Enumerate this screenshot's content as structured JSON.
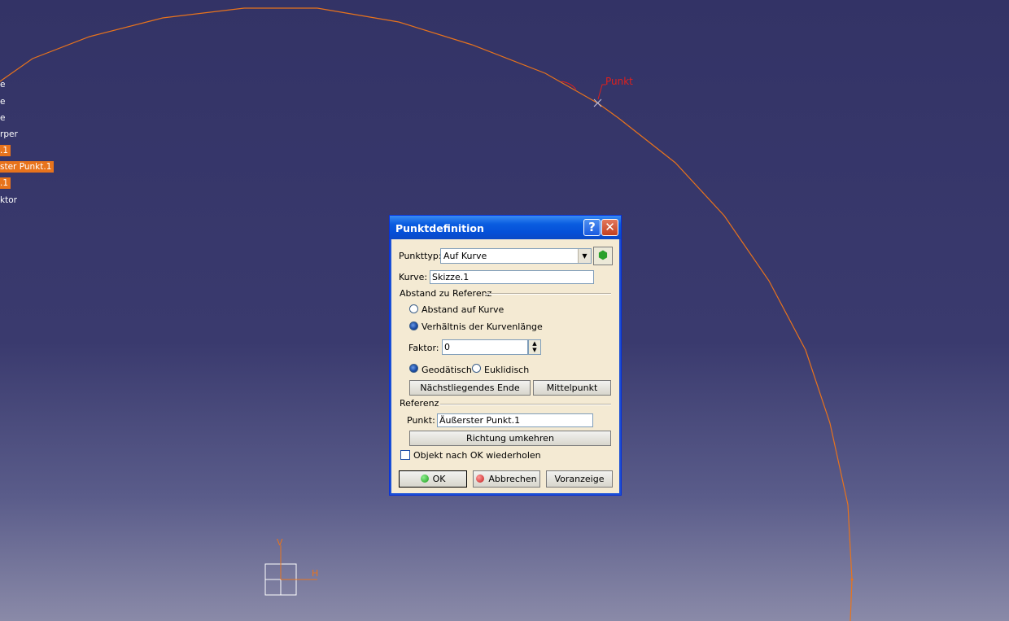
{
  "tree": {
    "items": [
      {
        "label": "e",
        "highlight": false
      },
      {
        "label": "e",
        "highlight": false
      },
      {
        "label": "e",
        "highlight": false
      },
      {
        "label": "rper",
        "highlight": false
      },
      {
        "label": ".1",
        "highlight": true
      },
      {
        "label": "ster Punkt.1",
        "highlight": true
      },
      {
        "label": ".1",
        "highlight": true
      },
      {
        "label": "ktor",
        "highlight": false
      }
    ]
  },
  "viewport": {
    "point_label": "Punkt",
    "axis_v_label": "V",
    "axis_h_label": "H",
    "curve_color": "#e8731c",
    "point_label_color": "#e0201c"
  },
  "dialog": {
    "title": "Punktdefinition",
    "help_glyph": "?",
    "close_glyph": "✕",
    "punkttyp_label": "Punkttyp:",
    "punkttyp_value": "Auf Kurve",
    "kurve_label": "Kurve:",
    "kurve_value": "Skizze.1",
    "abstand_group": "Abstand zu Referenz",
    "radio_abstand": "Abstand auf Kurve",
    "radio_verhaeltnis": "Verhältnis der Kurvenlänge",
    "faktor_label": "Faktor:",
    "faktor_value": "0",
    "radio_geodaetisch": "Geodätisch",
    "radio_euklidisch": "Euklidisch",
    "btn_naechstliegend": "Nächstliegendes Ende",
    "btn_mittelpunkt": "Mittelpunkt",
    "referenz_group": "Referenz",
    "punkt_label": "Punkt:",
    "punkt_value": "Äußerster Punkt.1",
    "btn_richtung": "Richtung umkehren",
    "checkbox_label": "Objekt nach OK wiederholen",
    "btn_ok": "OK",
    "btn_abbrechen": "Abbrechen",
    "btn_voranzeige": "Voranzeige"
  }
}
